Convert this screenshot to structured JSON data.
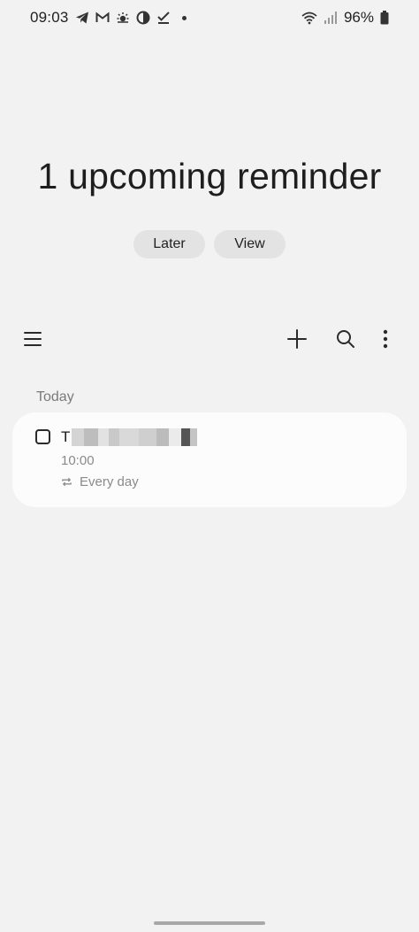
{
  "status_bar": {
    "time": "09:03",
    "battery": "96%"
  },
  "header": {
    "title": "1 upcoming reminder",
    "later_label": "Later",
    "view_label": "View"
  },
  "toolbar": {
    "menu_icon": "hamburger-menu-icon",
    "add_icon": "plus-icon",
    "search_icon": "search-icon",
    "more_icon": "more-vertical-icon"
  },
  "list": {
    "section": "Today",
    "items": [
      {
        "title_initial": "T",
        "time": "10:00",
        "repeat": "Every day"
      }
    ]
  },
  "colors": {
    "background": "#f2f2f2",
    "card": "#fcfcfc",
    "pill": "#e3e3e3"
  }
}
